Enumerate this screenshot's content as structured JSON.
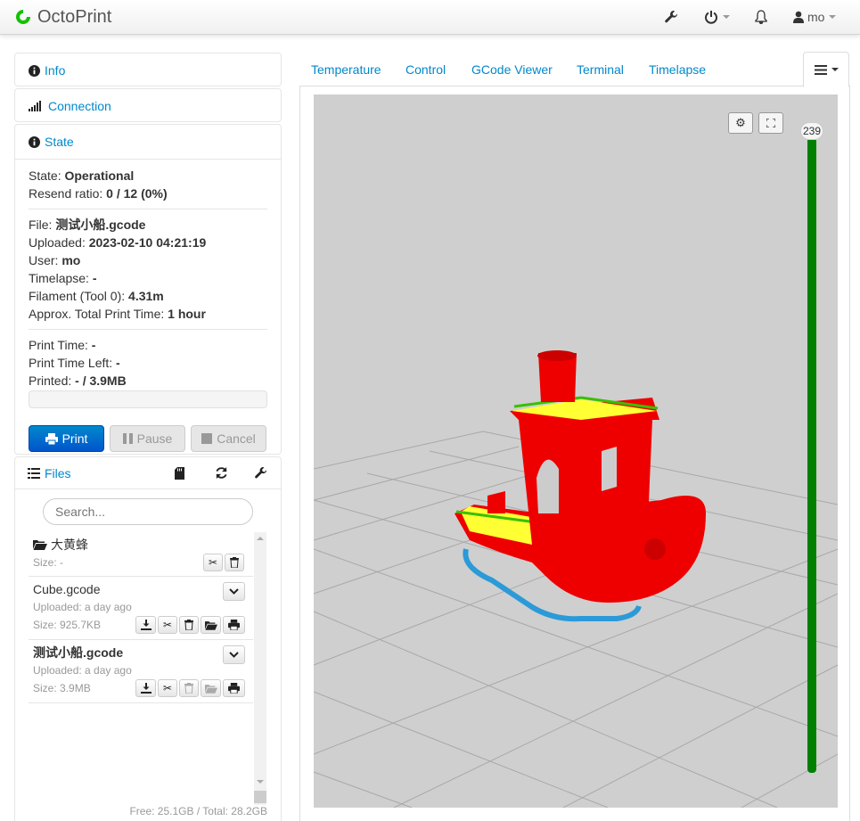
{
  "navbar": {
    "brand": "OctoPrint",
    "user": "mo"
  },
  "sidebar": {
    "info_label": "Info",
    "connection_label": "Connection",
    "state_label": "State",
    "state": {
      "state_label": "State:",
      "state_value": "Operational",
      "resend_label": "Resend ratio:",
      "resend_value": "0 / 12 (0%)",
      "file_label": "File:",
      "file_value": "测试小船.gcode",
      "uploaded_label": "Uploaded:",
      "uploaded_value": "2023-02-10 04:21:19",
      "user_label": "User:",
      "user_value": "mo",
      "timelapse_label": "Timelapse:",
      "timelapse_value": "-",
      "filament_label": "Filament (Tool 0):",
      "filament_value": "4.31m",
      "approx_label": "Approx. Total Print Time:",
      "approx_value": "1 hour",
      "print_time_label": "Print Time:",
      "print_time_value": "-",
      "print_time_left_label": "Print Time Left:",
      "print_time_left_value": "-",
      "printed_label": "Printed:",
      "printed_value": "- / 3.9MB",
      "progress": 0
    },
    "buttons": {
      "print": "Print",
      "pause": "Pause",
      "cancel": "Cancel"
    },
    "files": {
      "label": "Files",
      "search_placeholder": "Search...",
      "items": [
        {
          "name": "大黄蜂",
          "size": "Size: -"
        },
        {
          "name": "Cube.gcode",
          "uploaded": "Uploaded: a day ago",
          "size": "Size: 925.7KB"
        },
        {
          "name": "测试小船.gcode",
          "uploaded": "Uploaded: a day ago",
          "size": "Size: 3.9MB"
        }
      ],
      "free": "Free: 25.1GB / Total: 28.2GB"
    }
  },
  "tabs": [
    "Temperature",
    "Control",
    "GCode Viewer",
    "Terminal",
    "Timelapse"
  ],
  "viewer": {
    "layer": "239"
  },
  "colors": {
    "accent": "#0088cc",
    "model": "#ee0000",
    "infill": "#ffff33",
    "travel": "#2b9ad8",
    "slider": "#008000"
  }
}
